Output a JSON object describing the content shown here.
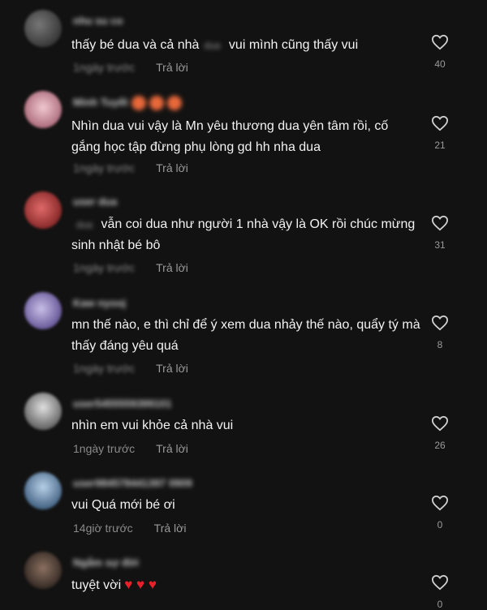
{
  "comments": [
    {
      "username": "nhu su co",
      "text_a": "thấy bé dua và cả nhà",
      "blurred": "dua",
      "text_b": " vui mình cũng thấy vui",
      "time": "1ngày trước",
      "reply": "Trả lời",
      "likes": "40"
    },
    {
      "username": "Minh Tuyết",
      "text": "Nhìn dua vui vậy là Mn yêu thương dua yên tâm rồi, cố gắng học tập đừng phụ lòng gd hh nha dua",
      "time": "1ngày trước",
      "reply": "Trả lời",
      "likes": "21"
    },
    {
      "username": "user dua",
      "blurred": "dua",
      "text": " vẫn coi dua như người 1 nhà vậy là OK rồi chúc mừng sinh nhật bé bô",
      "time": "1ngày trước",
      "reply": "Trả lời",
      "likes": "31"
    },
    {
      "username": "Kaw nyooj",
      "text": "mn thế nào, e thì chỉ để ý xem dua nhảy thế nào, quẩy tý mà thấy đáng yêu quá",
      "time": "1ngày trước",
      "reply": "Trả lời",
      "likes": "8"
    },
    {
      "username": "user5455559399101",
      "text": "nhìn em vui khỏe cả nhà vui",
      "time": "1ngày trước",
      "reply": "Trả lời",
      "likes": "26"
    },
    {
      "username": "user984578441397 0909",
      "text": "vui Quá mới bé ơi",
      "time": "14giờ trước",
      "reply": "Trả lời",
      "likes": "0"
    },
    {
      "username": "Ngắm sự đời",
      "text": "tuyệt vời",
      "time": "",
      "reply": "",
      "likes": "0"
    }
  ],
  "icons": {
    "like": "heart-outline-icon",
    "emoji": "red-heart-emoji"
  },
  "colors": {
    "background": "#121212",
    "text": "#f2f2f2",
    "meta": "#8a8a8a"
  }
}
